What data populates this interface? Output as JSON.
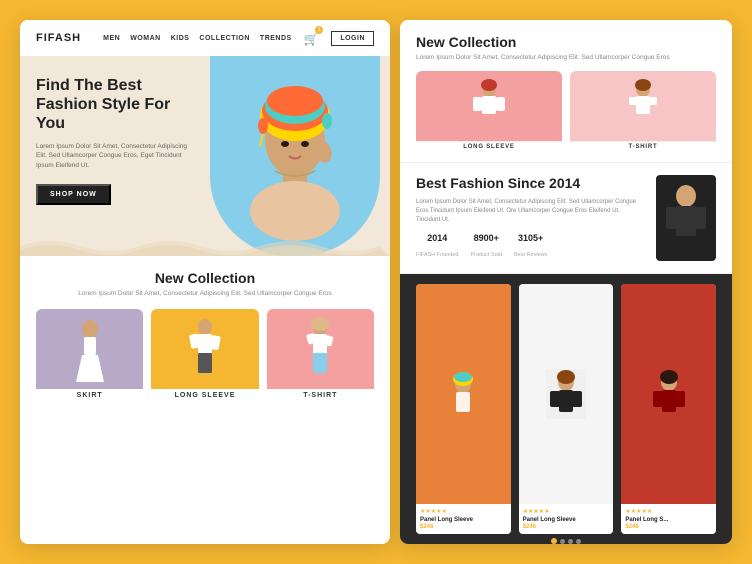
{
  "brand": "FIFASH",
  "navbar": {
    "links": [
      "MEN",
      "WOMAN",
      "KIDS",
      "COLLECTION",
      "TRENDS"
    ],
    "login_label": "LOGIN"
  },
  "hero": {
    "title": "Find The Best Fashion Style For You",
    "description": "Lorem Ipsum Dolor Sit Amet, Consectetur Adipiscing Elit. Sed Ullamcorper Congue Eros, Eget Tincidunt Ipsum Eleifend Ut.",
    "cta_label": "SHOP NOW"
  },
  "new_collection_left": {
    "title": "New Collection",
    "description": "Lorem Ipsum Dolor Sit Amet, Consectetur Adipiscing Elit. Sed Ullamcorper Congue Eros",
    "items": [
      {
        "label": "SKIRT",
        "color": "purple"
      },
      {
        "label": "LONG SLEEVE",
        "color": "yellow"
      },
      {
        "label": "T-SHIRT",
        "color": "pink"
      }
    ]
  },
  "new_collection_right": {
    "title": "New Collection",
    "description": "Lorem Ipsum Dolor Sit Amet, Consectetur Adipiscing Elit. Sed Ullamcorper Congue Eros",
    "items": [
      {
        "label": "LONG SLEEVE",
        "color": "pink-light"
      },
      {
        "label": "T-SHIRT",
        "color": "pink2"
      }
    ]
  },
  "best_fashion": {
    "title": "Best Fashion Since 2014",
    "description": "Lorem Ipsum Dolor Sit Amet, Consectetur Adipiscing Elit. Sed Ullamcorper Congue Eros Tincidunt Ipsum Eleifend Ut. Ore Ullamcorper Congue Eros Eleifend Ut. Tincidunt Ut.",
    "stats": [
      {
        "value": "2014",
        "label": "FIFASH Founded"
      },
      {
        "value": "8900+",
        "label": "Product Sold"
      },
      {
        "value": "3105+",
        "label": "Best Reviews"
      }
    ]
  },
  "products": {
    "items": [
      {
        "name": "Panel Long Sleeve",
        "price": "$246",
        "stars": "★★★★★",
        "color": "orange-bg"
      },
      {
        "name": "Panel Long Sleeve",
        "price": "$246",
        "stars": "★★★★★",
        "color": "white-bg"
      },
      {
        "name": "Panel Long S...",
        "price": "$246",
        "stars": "★★★★★",
        "color": "red-bg"
      }
    ],
    "pagination": [
      0,
      1,
      2,
      3
    ]
  },
  "icons": {
    "cart": "🛒",
    "models": [
      "👗",
      "👗",
      "👗"
    ],
    "hero_model": "👩",
    "fashion_model": "🧥"
  }
}
